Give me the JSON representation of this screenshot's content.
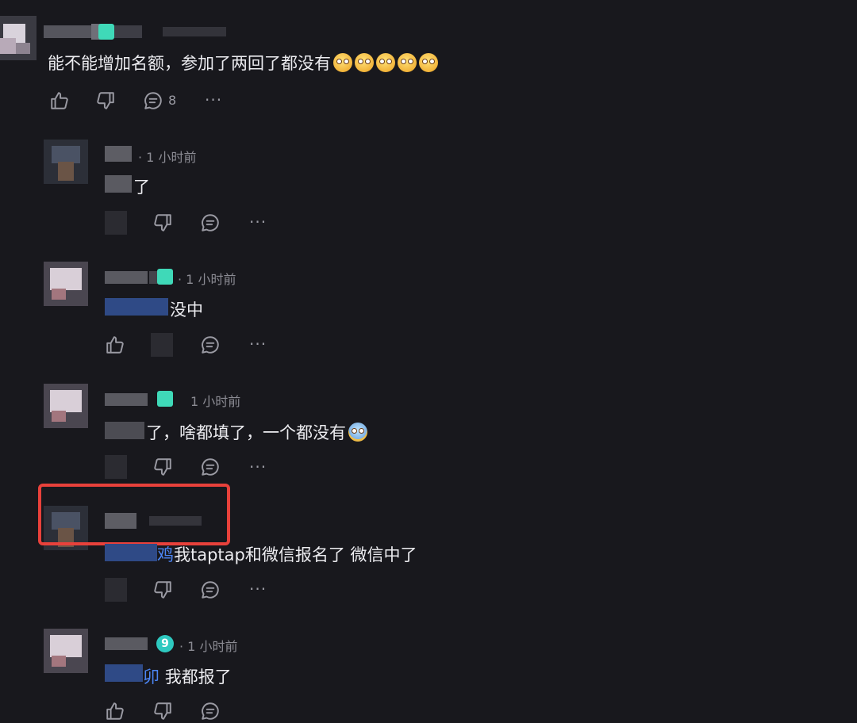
{
  "top_comment": {
    "text": "能不能增加名额，参加了两回了都没有",
    "emoji_icons": [
      "pleading-face-icon",
      "pleading-face-icon",
      "pleading-face-icon",
      "pleading-face-icon",
      "pleading-face-icon"
    ],
    "reply_count": "8",
    "more": "···"
  },
  "replies": [
    {
      "meta": "· 1 小时前",
      "text": "了",
      "more": "···"
    },
    {
      "meta": "· 1 小时前",
      "text": "没中",
      "more": "···"
    },
    {
      "meta": "1 小时前",
      "text": "了，啥都填了，一个都没有",
      "emoji_icon": "crying-face-icon",
      "more": "···"
    },
    {
      "mention": "鸡",
      "text": "我taptap和微信报名了 微信中了",
      "more": "···",
      "highlight_color": "#e8413b"
    },
    {
      "meta": "· 1 小时前",
      "badge": "9",
      "mention": "卯",
      "text": "我都报了",
      "more": "···"
    }
  ],
  "colors": {
    "background": "#18181d",
    "text": "#ececf0",
    "meta": "#8b8b93",
    "mention": "#4c86f5",
    "badge": "#3fd9b8",
    "highlight": "#e8413b"
  }
}
